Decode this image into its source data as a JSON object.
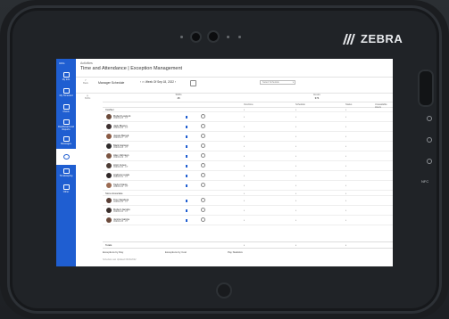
{
  "device": {
    "brand": "ZEBRA",
    "side_label": "NFC"
  },
  "sidebar": {
    "app_label": "UKG",
    "items": [
      {
        "label": "My Info",
        "icon": "user-card-icon"
      },
      {
        "label": "My Timecard",
        "icon": "timecard-icon"
      },
      {
        "label": "Check",
        "icon": "check-icon"
      },
      {
        "label": "Dashboard and Reports",
        "icon": "dashboard-icon"
      },
      {
        "label": "Messages",
        "icon": "message-icon"
      },
      {
        "label": "",
        "icon": "clock-icon"
      },
      {
        "label": "Timekeeping",
        "icon": "timekeeping-icon"
      },
      {
        "label": "Other",
        "icon": "more-icon"
      }
    ]
  },
  "header": {
    "breadcrumb": "Activities",
    "title": "Time and Attendance | Exception Management"
  },
  "toolbar": {
    "back_label": "Back",
    "title": "Manager Schedule",
    "week": "Week Of Sep 18, 2022",
    "select_label": "Select Schedule"
  },
  "left_tab_label": "Shifts",
  "summary": [
    {
      "label": "Shifts",
      "value": "46"
    },
    {
      "label": "Hours",
      "value": "374"
    }
  ],
  "columns": [
    "Overtime",
    "Schedule",
    "Status",
    "Unavailable Hours"
  ],
  "groups": [
    {
      "name": "Cashier",
      "employees": [
        {
          "name": "Robert Laurent",
          "id": "09900125 · FT",
          "avatar_color": "#6b4a3a"
        },
        {
          "name": "Jack Bowen",
          "id": "09900126 · FT",
          "avatar_color": "#3d3030"
        },
        {
          "name": "Jessie Benett",
          "id": "09900127 · PT",
          "avatar_color": "#8a5a44"
        },
        {
          "name": "Mark Hanson",
          "id": "09900128 · PT",
          "avatar_color": "#2e2a2a"
        },
        {
          "name": "Alex Johnson",
          "id": "09900129 · PT",
          "avatar_color": "#7a5340"
        },
        {
          "name": "Amir Jones",
          "id": "09900130 · FT",
          "avatar_color": "#4c3b34"
        },
        {
          "name": "Andrew Lewis",
          "id": "09900131 · FT",
          "avatar_color": "#2f2626"
        },
        {
          "name": "Taylor Davis",
          "id": "09900132 · PT",
          "avatar_color": "#9b6b52"
        }
      ]
    },
    {
      "name": "Store Associate",
      "employees": [
        {
          "name": "Troy Sanders",
          "id": "09900133 · FT",
          "avatar_color": "#5b4037"
        },
        {
          "name": "Robert Jacobs",
          "id": "09900134 · FT",
          "avatar_color": "#3a2f2c"
        },
        {
          "name": "Jennie Garcia",
          "id": "09900135 · PT",
          "avatar_color": "#6c4b3c"
        }
      ]
    }
  ],
  "dot": "•",
  "totals_label": "Totals",
  "exceptions": [
    "Exceptions by Day",
    "Exceptions by Cost",
    "Pay Statistics"
  ],
  "footer": "Schedule Last Updated 09/16/2022"
}
